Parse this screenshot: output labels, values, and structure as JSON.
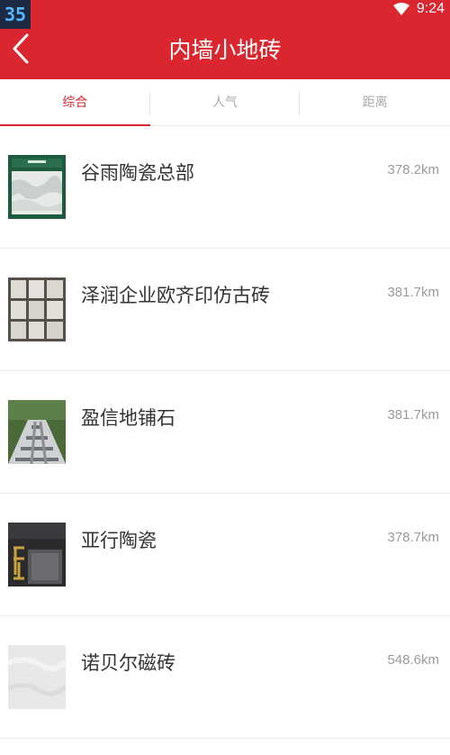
{
  "status_bar": {
    "badge": "35",
    "time": "9:24",
    "wifi_icon": "wifi-icon"
  },
  "header": {
    "title": "内墙小地砖",
    "back_icon": "chevron-left-icon",
    "background_color": "#d9262f"
  },
  "tabs": [
    {
      "label": "综合",
      "active": true
    },
    {
      "label": "人气",
      "active": false
    },
    {
      "label": "距离",
      "active": false
    }
  ],
  "stores": [
    {
      "name": "谷雨陶瓷总部",
      "distance": "378.2km"
    },
    {
      "name": "泽润企业欧齐印仿古砖",
      "distance": "381.7km"
    },
    {
      "name": "盈信地铺石",
      "distance": "381.7km"
    },
    {
      "name": "亚行陶瓷",
      "distance": "378.7km"
    },
    {
      "name": "诺贝尔磁砖",
      "distance": "548.6km"
    }
  ]
}
